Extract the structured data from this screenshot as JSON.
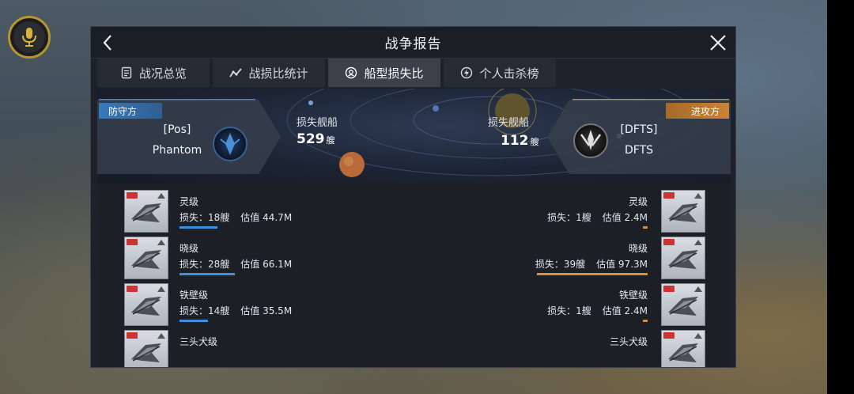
{
  "window": {
    "title": "战争报告"
  },
  "tabs": [
    {
      "label": "战况总览",
      "icon": "document-icon"
    },
    {
      "label": "战损比统计",
      "icon": "trend-icon"
    },
    {
      "label": "船型损失比",
      "icon": "ship-type-icon"
    },
    {
      "label": "个人击杀榜",
      "icon": "lightning-icon"
    }
  ],
  "active_tab": "船型损失比",
  "defender": {
    "side_label": "防守方",
    "tag": "[Pos]",
    "name": "Phantom",
    "loss_label": "损失舰船",
    "loss_count": "529",
    "unit": "艘",
    "color": "#4a8fd6"
  },
  "attacker": {
    "side_label": "进攻方",
    "tag": "[DFTS]",
    "name": "DFTS",
    "loss_label": "损失舰船",
    "loss_count": "112",
    "unit": "艘",
    "color": "#d98e3e"
  },
  "stat_labels": {
    "loss": "损失：",
    "value": "估值"
  },
  "ships": [
    {
      "name": "灵级",
      "left": {
        "loss": "18艘",
        "value": "44.7M",
        "bar_fraction": 0.34
      },
      "right": {
        "loss": "1艘",
        "value": "2.4M",
        "bar_fraction": 0.04
      }
    },
    {
      "name": "晓级",
      "left": {
        "loss": "28艘",
        "value": "66.1M",
        "bar_fraction": 0.5
      },
      "right": {
        "loss": "39艘",
        "value": "97.3M",
        "bar_fraction": 1.0
      }
    },
    {
      "name": "铁壁级",
      "left": {
        "loss": "14艘",
        "value": "35.5M",
        "bar_fraction": 0.26
      },
      "right": {
        "loss": "1艘",
        "value": "2.4M",
        "bar_fraction": 0.04
      }
    },
    {
      "name": "三头犬级",
      "left": {
        "loss": "",
        "value": "",
        "bar_fraction": 0
      },
      "right": {
        "loss": "",
        "value": "",
        "bar_fraction": 0
      }
    }
  ]
}
